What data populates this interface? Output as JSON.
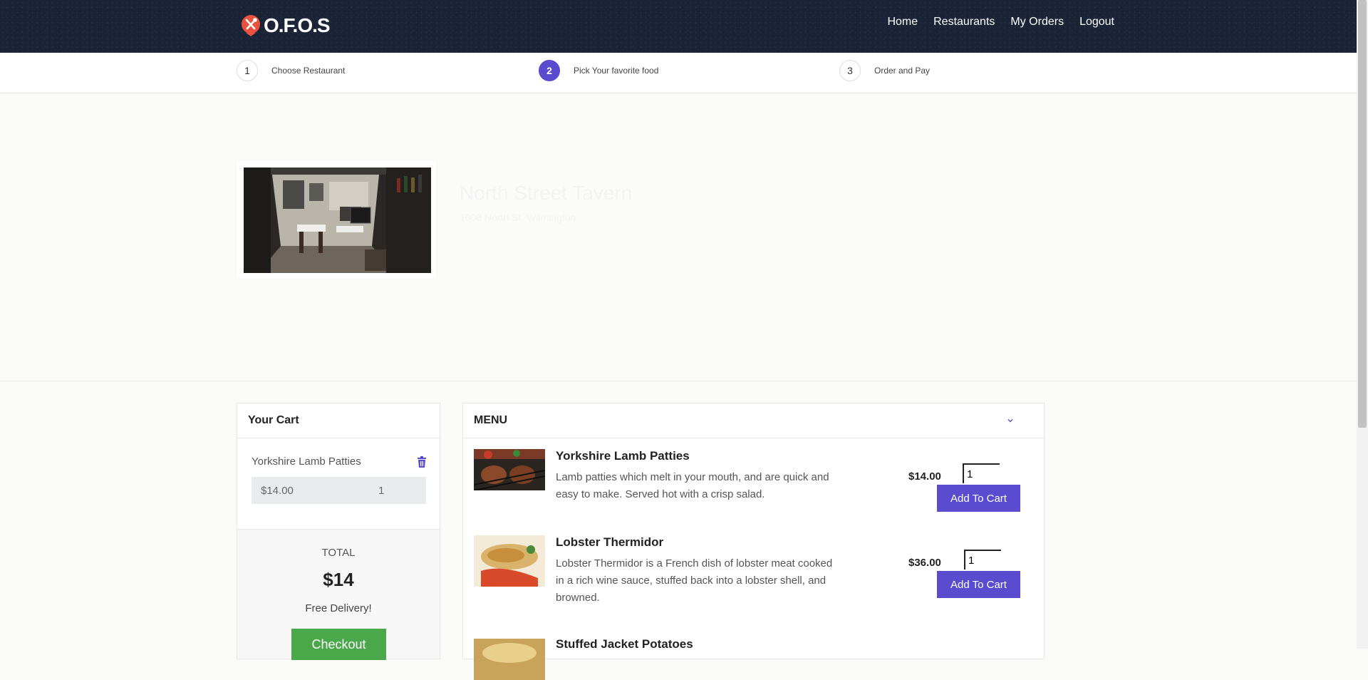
{
  "brand": {
    "logo_text": "O.F.O.S",
    "logo_icon": "fork-spoon-pin-icon"
  },
  "nav": [
    {
      "label": "Home"
    },
    {
      "label": "Restaurants"
    },
    {
      "label": "My Orders"
    },
    {
      "label": "Logout"
    }
  ],
  "steps": [
    {
      "number": "1",
      "label": "Choose Restaurant",
      "active": false
    },
    {
      "number": "2",
      "label": "Pick Your favorite food",
      "active": true
    },
    {
      "number": "3",
      "label": "Order and Pay",
      "active": false
    }
  ],
  "restaurant": {
    "name": "North Street Tavern",
    "address": "1008 North St. Wilmington"
  },
  "cart": {
    "title": "Your Cart",
    "items": [
      {
        "name": "Yorkshire Lamb Patties",
        "price": "$14.00",
        "qty": "1"
      }
    ],
    "total_label": "TOTAL",
    "total_value": "$14",
    "delivery": "Free Delivery!",
    "checkout_label": "Checkout"
  },
  "menu": {
    "title": "MENU",
    "items": [
      {
        "title": "Yorkshire Lamb Patties",
        "desc": "Lamb patties which melt in your mouth, and are quick and easy to make. Served hot with a crisp salad.",
        "price": "$14.00",
        "qty": "1",
        "button": "Add To Cart"
      },
      {
        "title": "Lobster Thermidor",
        "desc": "Lobster Thermidor is a French dish of lobster meat cooked in a rich wine sauce, stuffed back into a lobster shell, and browned.",
        "price": "$36.00",
        "qty": "1",
        "button": "Add To Cart"
      },
      {
        "title": "Stuffed Jacket Potatoes",
        "desc": "",
        "price": "",
        "qty": "",
        "button": ""
      }
    ]
  },
  "colors": {
    "header_bg": "#1b2336",
    "accent_purple": "#5a4bcf",
    "checkout_green": "#4aa84b",
    "logo_red": "#e8523f"
  }
}
